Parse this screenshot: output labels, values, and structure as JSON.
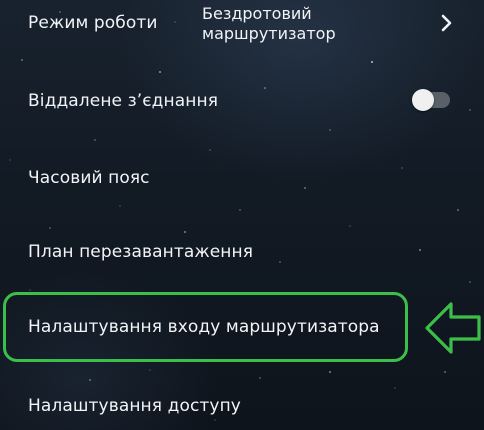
{
  "settings": {
    "mode": {
      "label": "Режим роботи",
      "value_line1": "Бездротовий",
      "value_line2": "маршрутизатор",
      "chevron_icon": "chevron-right-icon"
    },
    "remote": {
      "label": "Віддалене з’єднання",
      "toggle_state": "off"
    },
    "timezone": {
      "label": "Часовий пояс"
    },
    "reboot_plan": {
      "label": "План перезавантаження"
    },
    "router_login": {
      "label": "Налаштування входу маршрутизатора"
    },
    "access": {
      "label": "Налаштування доступу"
    }
  },
  "annotation": {
    "highlight_color": "#3cbf4a",
    "arrow_icon": "arrow-left-outline-icon"
  },
  "colors": {
    "background": "#141c26",
    "text": "#f2f4f7",
    "toggle_track": "#5a6068",
    "toggle_knob": "#f0f0f0"
  }
}
